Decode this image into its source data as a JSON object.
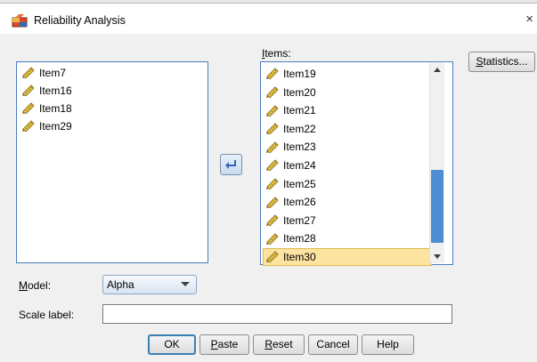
{
  "window": {
    "title": "Reliability Analysis",
    "close_glyph": "×"
  },
  "source_list": {
    "items": [
      "Item7",
      "Item16",
      "Item18",
      "Item29"
    ]
  },
  "items_panel": {
    "label_accel": "I",
    "label_rest": "tems:",
    "items": [
      "Item19",
      "Item20",
      "Item21",
      "Item22",
      "Item23",
      "Item24",
      "Item25",
      "Item26",
      "Item27",
      "Item28",
      "Item30"
    ],
    "selected": "Item30"
  },
  "statistics_button": {
    "accel": "S",
    "rest": "tatistics..."
  },
  "model": {
    "label_accel": "M",
    "label_rest": "odel:",
    "value": "Alpha"
  },
  "scale_label": {
    "label": "Scale label:",
    "value": ""
  },
  "buttons": {
    "ok": "OK",
    "paste_accel": "P",
    "paste_rest": "aste",
    "reset_accel": "R",
    "reset_rest": "eset",
    "cancel": "Cancel",
    "help": "Help"
  },
  "icons": {
    "variable": "ruler-scale-icon",
    "move": "move-left-arrow-icon",
    "app": "spss-scale-icon"
  },
  "colors": {
    "accent": "#4a7bbf",
    "selection": "#fce4a0",
    "arrow_button": "#c8dbef"
  }
}
